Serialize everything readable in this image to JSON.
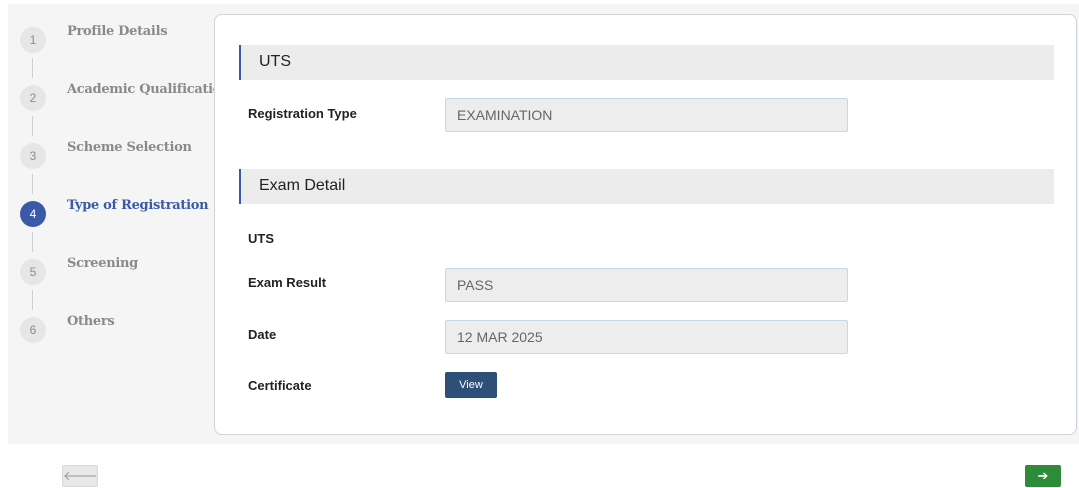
{
  "stepper": {
    "steps": [
      {
        "number": "1",
        "label": "Profile Details"
      },
      {
        "number": "2",
        "label": "Academic Qualifications"
      },
      {
        "number": "3",
        "label": "Scheme Selection"
      },
      {
        "number": "4",
        "label": "Type of Registration"
      },
      {
        "number": "5",
        "label": "Screening"
      },
      {
        "number": "6",
        "label": "Others"
      }
    ],
    "active_step": "4"
  },
  "uts_section": {
    "title": "UTS",
    "registration_type_label": "Registration Type",
    "registration_type_value": "EXAMINATION"
  },
  "exam_section": {
    "title": "Exam Detail",
    "subheading": "UTS",
    "exam_result_label": "Exam Result",
    "exam_result_value": "PASS",
    "date_label": "Date",
    "date_value": "12 MAR 2025",
    "certificate_label": "Certificate",
    "view_button_label": "View"
  },
  "navigation": {
    "prev_icon": "arrow-left-icon",
    "prev_glyph": "🡐",
    "next_icon": "arrow-right-icon",
    "next_glyph": "➔"
  },
  "colors": {
    "accent": "#3a5aa8",
    "view_button": "#2e4f78",
    "next_button": "#2e8b3a"
  }
}
